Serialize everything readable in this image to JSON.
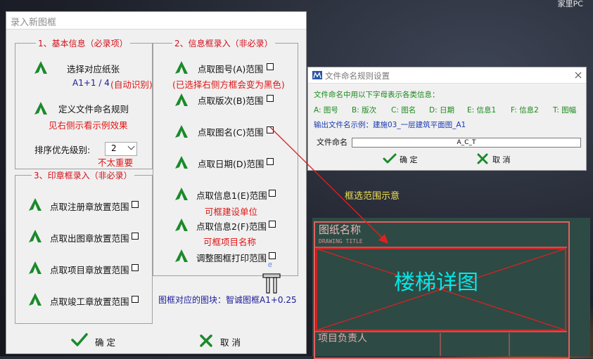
{
  "desktop": {
    "label": "家里PC"
  },
  "main_dialog": {
    "title": "录入新图框",
    "group_basic": {
      "title": "1、基本信息（必录项）",
      "select_paper": "选择对应纸张",
      "paper_value": "A1+1 / 4",
      "auto_note": "(自动识别)",
      "define_rule": "定义文件命名规则",
      "rule_note": "见右侧示看示例效果",
      "priority_label": "排序优先级别:",
      "priority_value": "2",
      "priority_note": "不太重要"
    },
    "group_stamp": {
      "title": "3、印章框录入（非必录）",
      "items": [
        "点取注册章放置范围",
        "点取出图章放置范围",
        "点取项目章放置范围",
        "点取竣工章放置范围"
      ]
    },
    "group_info": {
      "title": "2、信息框录入（非必录）",
      "items": [
        "点取图号(A)范围",
        "点取版次(B)范围",
        "点取图名(C)范围",
        "点取日期(D)范围",
        "点取信息1(E)范围",
        "点取信息2(F)范围",
        "调整图框打印范围"
      ],
      "checkbox_note": "(已选择右侧方框会变为黑色)",
      "info1_note": "可框建设单位",
      "info2_note": "可框项目名称"
    },
    "block_label": "图框对应的图块：智诚图框A1+0.25",
    "ok_label": "确 定",
    "cancel_label": "取 消"
  },
  "sub_dialog": {
    "title": "文件命名规则设置",
    "desc": "文件命名中用以下字母表示各类信息：",
    "codes": [
      "A: 图号",
      "B: 版次",
      "C: 图名",
      "D: 日期",
      "E: 信息1",
      "F: 信息2",
      "T: 图幅"
    ],
    "example": "输出文件名示例：建施03_一层建筑平面图_A1",
    "field_label": "文件命名",
    "field_value": "A_C_T",
    "ok_label": "确 定",
    "cancel_label": "取 消"
  },
  "annotation": {
    "label": "框选范围示意"
  },
  "preview": {
    "title_cn": "图纸名称",
    "title_en": "DRAWING TITLE",
    "drawing_name": "楼梯详图",
    "bottom_text": "项目负责人"
  },
  "colors": {
    "red_note": "#e01515",
    "green_icon": "#1a8a2a",
    "sub_green": "#1a8a1a",
    "preview_bg": "#2e4a44",
    "drawing_text": "#00e8e8"
  }
}
